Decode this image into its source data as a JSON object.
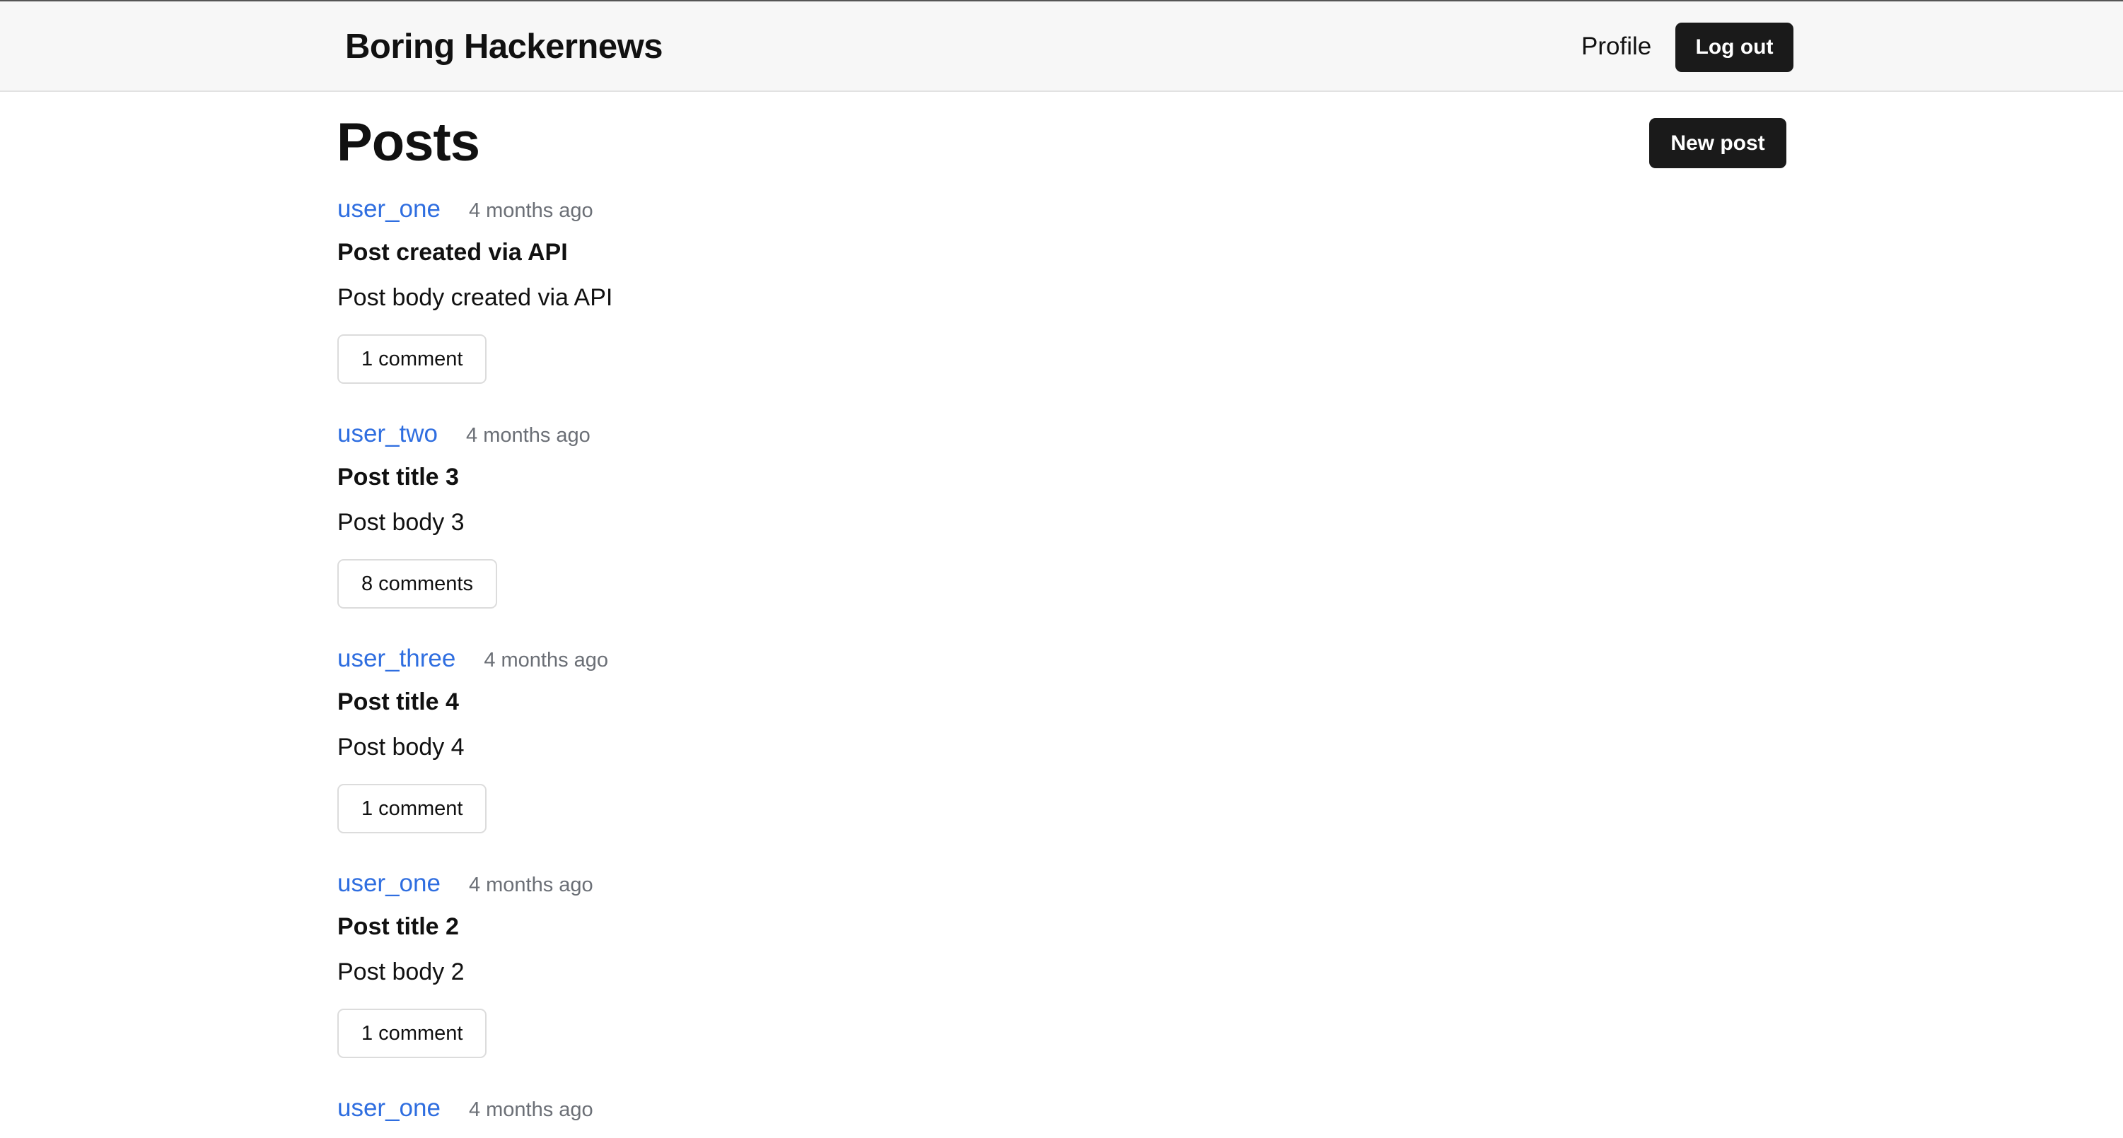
{
  "header": {
    "brand": "Boring Hackernews",
    "profile_label": "Profile",
    "logout_label": "Log out"
  },
  "main": {
    "title": "Posts",
    "new_post_label": "New post",
    "posts": [
      {
        "author": "user_one",
        "time": "4 months ago",
        "title": "Post created via API",
        "body": "Post body created via API",
        "comments": "1 comment"
      },
      {
        "author": "user_two",
        "time": "4 months ago",
        "title": "Post title 3",
        "body": "Post body 3",
        "comments": "8 comments"
      },
      {
        "author": "user_three",
        "time": "4 months ago",
        "title": "Post title 4",
        "body": "Post body 4",
        "comments": "1 comment"
      },
      {
        "author": "user_one",
        "time": "4 months ago",
        "title": "Post title 2",
        "body": "Post body 2",
        "comments": "1 comment"
      },
      {
        "author": "user_one",
        "time": "4 months ago"
      }
    ]
  },
  "colors": {
    "link": "#2f6ee0",
    "button_dark": "#1a1a1a",
    "header_bg": "#f7f7f7",
    "muted_text": "#6b6f76"
  }
}
